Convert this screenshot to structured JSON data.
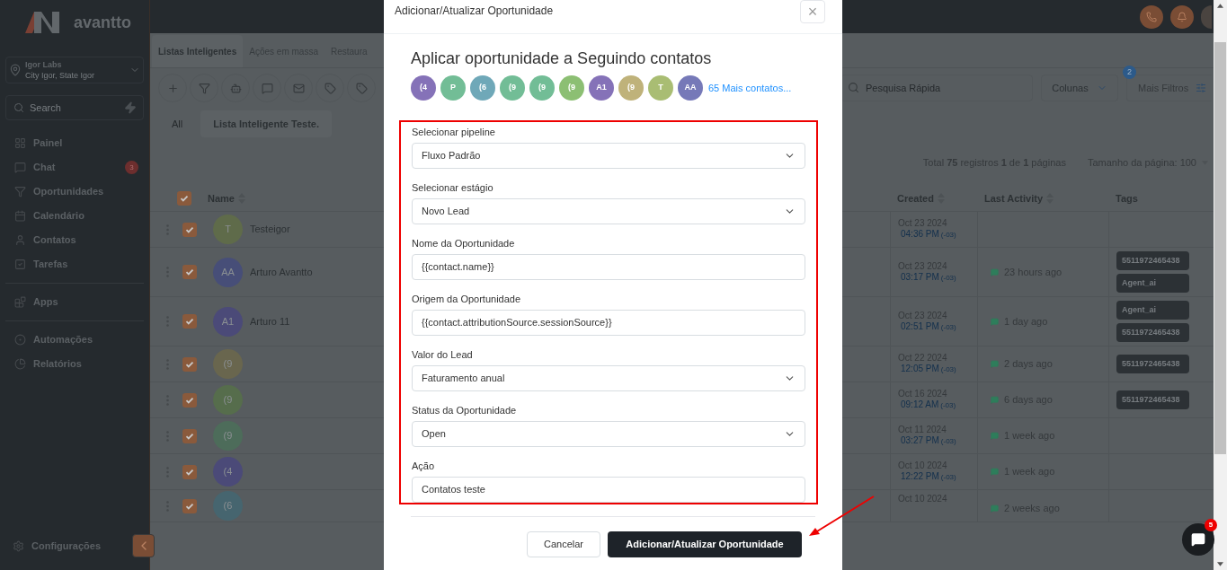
{
  "sidebar": {
    "logo": "avantto",
    "location": {
      "name": "Igor Labs",
      "address": "City Igor, State Igor"
    },
    "search": {
      "placeholder": "Search"
    },
    "groups": [
      [
        {
          "label": "Painel"
        },
        {
          "label": "Chat",
          "badge": "3"
        },
        {
          "label": "Oportunidades"
        },
        {
          "label": "Calendário"
        },
        {
          "label": "Contatos"
        },
        {
          "label": "Tarefas"
        }
      ],
      [
        {
          "label": "Apps"
        }
      ],
      [
        {
          "label": "Automações"
        },
        {
          "label": "Relatórios"
        }
      ]
    ],
    "settings": "Configurações"
  },
  "tabs": [
    {
      "label": "Listas Inteligentes",
      "selected": true
    },
    {
      "label": "Ações em massa",
      "selected": false
    },
    {
      "label": "Restaura",
      "selected": false
    }
  ],
  "toolbar": {
    "search": {
      "placeholder": "Pesquisa Rápida"
    },
    "columns_button": "Colunas",
    "filters_button": "Mais Filtros",
    "filters_badge": "2"
  },
  "lists": [
    {
      "label": "All",
      "selected": false
    },
    {
      "label": "Lista Inteligente Teste.",
      "selected": true
    }
  ],
  "summary": {
    "total": "Total **75** registros **1** de **1** páginas",
    "page_size": "Tamanho da página: 100"
  },
  "table": {
    "all_checked": true,
    "columns": [
      "Name",
      "Created",
      "Last Activity",
      "Tags"
    ],
    "rows": [
      {
        "checked": true,
        "initials": "T",
        "color": "#5f6b4a",
        "name": "Testeigor",
        "date": "Oct 23 2024",
        "time": "04:36 PM",
        "tz": "(-03)",
        "activity": "",
        "tags": []
      },
      {
        "checked": true,
        "initials": "AA",
        "color": "#474e78",
        "name": "Arturo Avantto",
        "date": "Oct 23 2024",
        "time": "03:17 PM",
        "tz": "(-03)",
        "activity": "23 hours ago",
        "tags": [
          "5511972465438",
          "Agent_ai"
        ]
      },
      {
        "checked": true,
        "initials": "A1",
        "color": "#4b4a78",
        "name": "Arturo 11",
        "date": "Oct 23 2024",
        "time": "02:51 PM",
        "tz": "(-03)",
        "activity": "1 day ago",
        "tags": [
          "Agent_ai",
          "5511972465438"
        ]
      },
      {
        "checked": true,
        "initials": "(9",
        "color": "#69664e",
        "name": "",
        "date": "Oct 22 2024",
        "time": "12:05 PM",
        "tz": "(-03)",
        "activity": "2 days ago",
        "tags": [
          "5511972465438"
        ]
      },
      {
        "checked": true,
        "initials": "(9",
        "color": "#566d4c",
        "name": "",
        "date": "Oct 16 2024",
        "time": "09:12 AM",
        "tz": "(-03)",
        "activity": "6 days ago",
        "tags": [
          "5511972465438"
        ]
      },
      {
        "checked": true,
        "initials": "(9",
        "color": "#4d6c5a",
        "name": "",
        "date": "Oct 11 2024",
        "time": "03:27 PM",
        "tz": "(-03)",
        "activity": "1 week ago",
        "tags": []
      },
      {
        "checked": true,
        "initials": "(4",
        "color": "#4b4a78",
        "name": "",
        "date": "Oct 10 2024",
        "time": "12:22 PM",
        "tz": "(-03)",
        "activity": "1 week ago",
        "tags": []
      },
      {
        "checked": true,
        "initials": "(6",
        "color": "#46656f",
        "name": "",
        "date": "Oct 10 2024",
        "time": "",
        "tz": "",
        "activity": "2 weeks ago",
        "tags": []
      }
    ]
  },
  "chat_badge": "5",
  "modal": {
    "header": "Adicionar/Atualizar Oportunidade",
    "close": "×",
    "title": "Aplicar oportunidade a Seguindo contatos",
    "contacts": [
      {
        "initials": "(4",
        "color": "#8572b8"
      },
      {
        "initials": "P",
        "color": "#72bd96"
      },
      {
        "initials": "(6",
        "color": "#6fa8b8"
      },
      {
        "initials": "(9",
        "color": "#72bd96"
      },
      {
        "initials": "(9",
        "color": "#72bd96"
      },
      {
        "initials": "(9",
        "color": "#8cbf73"
      },
      {
        "initials": "A1",
        "color": "#8572b8"
      },
      {
        "initials": "(9",
        "color": "#bfb27a"
      },
      {
        "initials": "T",
        "color": "#a9bd73"
      },
      {
        "initials": "AA",
        "color": "#7679b8"
      }
    ],
    "more_contacts": "65 Mais contatos...",
    "fields": [
      {
        "kind": "select",
        "label": "Selecionar pipeline",
        "value": "Fluxo Padrão"
      },
      {
        "kind": "select",
        "label": "Selecionar estágio",
        "value": "Novo Lead"
      },
      {
        "kind": "text",
        "label": "Nome da Oportunidade",
        "value": "{{contact.name}}"
      },
      {
        "kind": "text",
        "label": "Origem da Oportunidade",
        "value": "{{contact.attributionSource.sessionSource}}"
      },
      {
        "kind": "select",
        "label": "Valor do Lead",
        "value": "Faturamento anual"
      },
      {
        "kind": "select",
        "label": "Status da Oportunidade",
        "value": "Open"
      },
      {
        "kind": "text",
        "label": "Ação",
        "value": "Contatos teste"
      }
    ],
    "buttons": [
      {
        "label": "Cancelar",
        "kind": "secondary"
      },
      {
        "label": "Adicionar/Atualizar Oportunidade",
        "kind": "primary"
      }
    ]
  }
}
